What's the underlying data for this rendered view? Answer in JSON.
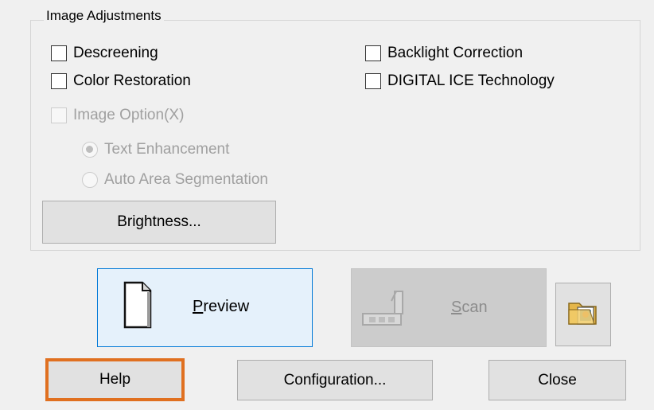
{
  "group": {
    "title": "Image Adjustments"
  },
  "checkboxes": {
    "descreening": "Descreening",
    "color_restoration": "Color Restoration",
    "image_option": "Image Option(X)",
    "backlight_correction": "Backlight Correction",
    "digital_ice": "DIGITAL ICE Technology"
  },
  "radios": {
    "text_enhancement": "Text Enhancement",
    "auto_area_segmentation": "Auto Area Segmentation"
  },
  "buttons": {
    "brightness": "Brightness...",
    "preview_mnemonic": "P",
    "preview_rest": "review",
    "scan_mnemonic": "S",
    "scan_rest": "can",
    "help": "Help",
    "configuration": "Configuration...",
    "close": "Close"
  },
  "icons": {
    "preview": "document-page-icon",
    "scan": "scanner-icon",
    "folder": "image-folder-icon"
  },
  "colors": {
    "dialog_bg": "#f0f0f0",
    "preview_bg": "#e5f1fb",
    "preview_border": "#0078d7",
    "help_highlight": "#e07020"
  }
}
